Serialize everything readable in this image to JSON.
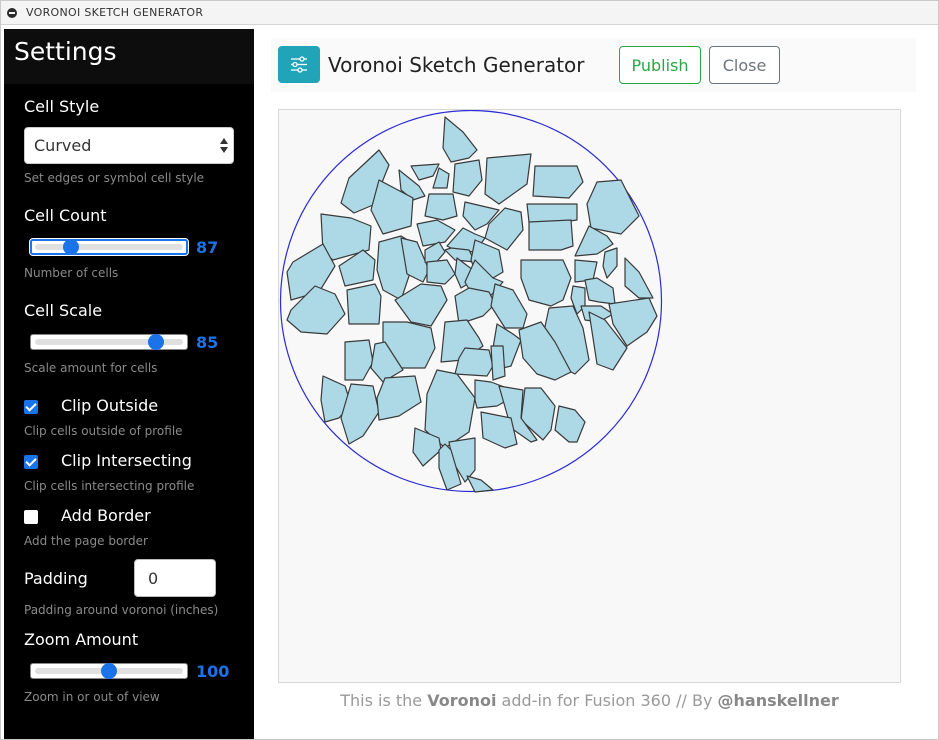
{
  "window": {
    "title": "VORONOI SKETCH GENERATOR"
  },
  "sidebar": {
    "title": "Settings",
    "cell_style": {
      "label": "Cell Style",
      "value": "Curved",
      "help": "Set edges or symbol cell style"
    },
    "cell_count": {
      "label": "Cell Count",
      "value": "87",
      "fraction": 0.22,
      "help": "Number of cells"
    },
    "cell_scale": {
      "label": "Cell Scale",
      "value": "85",
      "fraction": 0.85,
      "help": "Scale amount for cells"
    },
    "clip_outside": {
      "label": "Clip Outside",
      "checked": true,
      "help": "Clip cells outside of profile"
    },
    "clip_intersecting": {
      "label": "Clip Intersecting",
      "checked": true,
      "help": "Clip cells intersecting profile"
    },
    "add_border": {
      "label": "Add Border",
      "checked": false,
      "help": "Add the page border"
    },
    "padding": {
      "label": "Padding",
      "value": "0",
      "help": "Padding around voronoi (inches)"
    },
    "zoom": {
      "label": "Zoom Amount",
      "value": "100",
      "fraction": 0.5,
      "help": "Zoom in or out of view"
    }
  },
  "main": {
    "title": "Voronoi Sketch Generator",
    "publish_label": "Publish",
    "close_label": "Close"
  },
  "footer": {
    "prefix": "This is the ",
    "name": "Voronoi",
    "middle": " add-in for Fusion 360 // By ",
    "author": "@hanskellner"
  },
  "colors": {
    "accent": "#1a73e8",
    "cell_fill": "#add8e6",
    "profile_stroke": "#2b2bd6",
    "publish": "#28a745",
    "close": "#6c757d",
    "app_icon": "#21a3b8"
  },
  "icons": {
    "window": "minus-circle-icon",
    "app": "sliders-icon",
    "select": "updown-chevron-icon",
    "check": "checkmark-icon"
  }
}
